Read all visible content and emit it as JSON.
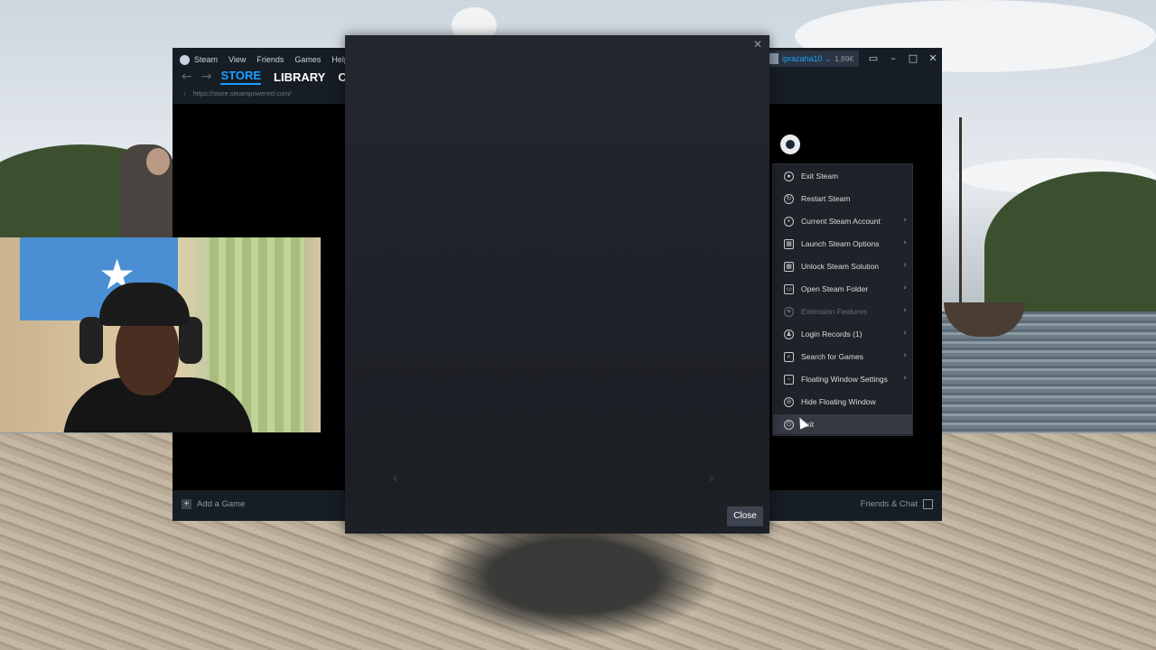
{
  "steam": {
    "menu": [
      "Steam",
      "View",
      "Friends",
      "Games",
      "Help"
    ],
    "tabs": [
      "STORE",
      "LIBRARY",
      "COM"
    ],
    "url": "https://store.steampowered.com/",
    "account_name": "iprazaha10",
    "account_balance": "1,89€",
    "add_game": "Add a Game",
    "friends_chat": "Friends & Chat"
  },
  "modal": {
    "close_label": "Close"
  },
  "context_menu": {
    "items": [
      {
        "label": "Exit Steam",
        "icon": "power-circle-icon",
        "submenu": false,
        "enabled": true
      },
      {
        "label": "Restart Steam",
        "icon": "refresh-icon",
        "submenu": false,
        "enabled": true
      },
      {
        "label": "Current Steam Account",
        "icon": "location-pin-icon",
        "submenu": true,
        "enabled": true
      },
      {
        "label": "Launch Steam Options",
        "icon": "grid-icon",
        "submenu": true,
        "enabled": true
      },
      {
        "label": "Unlock Steam Solution",
        "icon": "grid-icon",
        "submenu": true,
        "enabled": true
      },
      {
        "label": "Open Steam Folder",
        "icon": "folder-icon",
        "submenu": true,
        "enabled": true
      },
      {
        "label": "Extension Features",
        "icon": "puzzle-icon",
        "submenu": true,
        "enabled": false
      },
      {
        "label": "Login Records (1)",
        "icon": "user-icon",
        "submenu": true,
        "enabled": true
      },
      {
        "label": "Search for Games",
        "icon": "search-box-icon",
        "submenu": true,
        "enabled": true
      },
      {
        "label": "Floating Window Settings",
        "icon": "window-icon",
        "submenu": true,
        "enabled": true
      },
      {
        "label": "Hide Floating Window",
        "icon": "eye-off-icon",
        "submenu": false,
        "enabled": true
      },
      {
        "label": "Exit",
        "icon": "power-icon",
        "submenu": false,
        "enabled": true
      }
    ]
  },
  "colors": {
    "steam_blue": "#1a9fff",
    "steam_dark": "#171d25",
    "menu_bg": "#1f2228"
  }
}
